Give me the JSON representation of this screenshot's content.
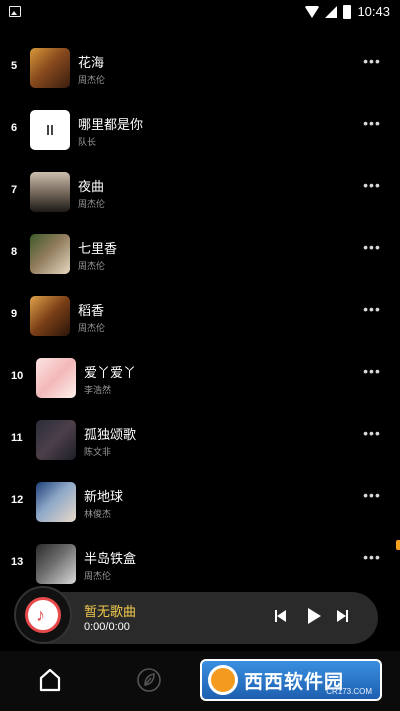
{
  "status_bar": {
    "time": "10:43"
  },
  "songs": [
    {
      "num": "5",
      "title": "花海",
      "artist": "周杰伦"
    },
    {
      "num": "6",
      "title": "哪里都是你",
      "artist": "队长"
    },
    {
      "num": "7",
      "title": "夜曲",
      "artist": "周杰伦"
    },
    {
      "num": "8",
      "title": "七里香",
      "artist": "周杰伦"
    },
    {
      "num": "9",
      "title": "稻香",
      "artist": "周杰伦"
    },
    {
      "num": "10",
      "title": "爱丫爱丫",
      "artist": "李浩然"
    },
    {
      "num": "11",
      "title": "孤独颂歌",
      "artist": "陈文非"
    },
    {
      "num": "12",
      "title": "新地球",
      "artist": "林俊杰"
    },
    {
      "num": "13",
      "title": "半岛铁盒",
      "artist": "周杰伦"
    }
  ],
  "more_label": "•••",
  "player": {
    "song": "暂无歌曲",
    "time": "0:00/0:00",
    "note_glyph": "♪"
  },
  "watermark": {
    "text": "西西软件园",
    "sub": "CR173.COM"
  }
}
